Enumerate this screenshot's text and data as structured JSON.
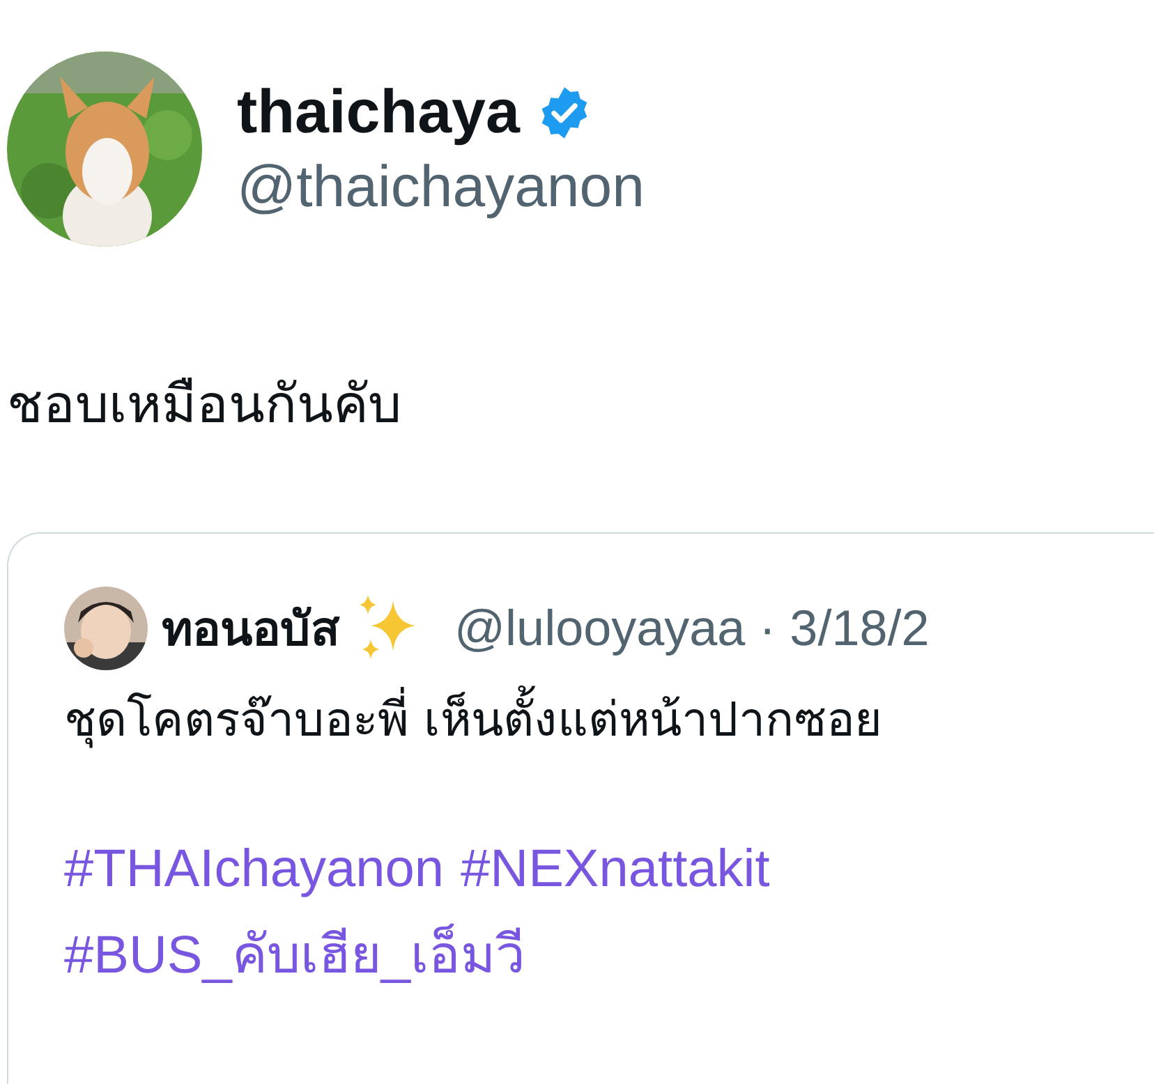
{
  "author": {
    "name": "thaichaya",
    "verified": true,
    "handle": "@thaichayanon"
  },
  "text": "ชอบเหมือนกันคับ",
  "quote": {
    "name": "ทอนอบัส",
    "handle": "@lulooyayaa",
    "separator": "·",
    "date": "3/18/2",
    "text": "ชุดโคตรจ๊าบอะพี่ เห็นตั้งแต่หน้าปากซอย",
    "hashtag_lines": [
      [
        "#THAIchayanon",
        "#NEXnattakit"
      ],
      [
        "#BUS_คับเฮีย_เอ็มวี"
      ]
    ]
  }
}
